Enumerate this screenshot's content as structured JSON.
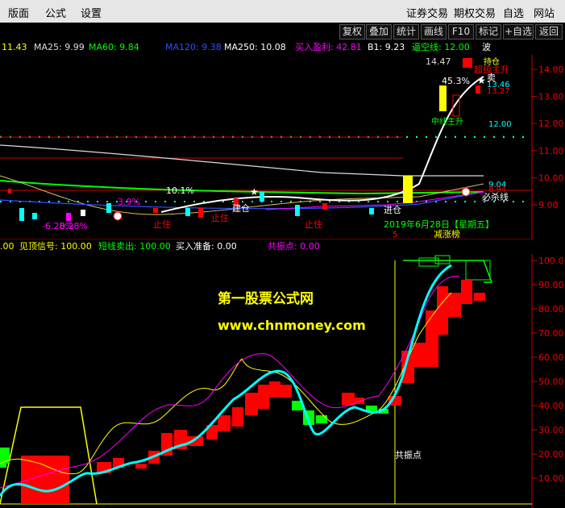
{
  "menu": {
    "items": [
      "版面",
      "公式",
      "设置"
    ],
    "right": [
      "证券交易",
      "期权交易",
      "自选",
      "网站"
    ],
    "min_icon": "minimize-icon"
  },
  "toolbar": {
    "buttons": [
      "复权",
      "叠加",
      "统计",
      "画线",
      "F10",
      "标记",
      "+自选",
      "返回"
    ]
  },
  "header_top": {
    "ma_prefix": "11.43",
    "ma25": "MA25: 9.99",
    "ma60": "MA60: 9.84",
    "ma120": "MA120: 9.38",
    "ma250": "MA250: 10.08",
    "buy_profit": "买入盈利: 42.81",
    "b1": "B1: 9.23",
    "empty_line": "逼空线: 12.00",
    "wave": "波"
  },
  "colors": {
    "bg": "#000000",
    "red": "#ff0000",
    "green": "#00ff00",
    "yellow": "#ffff00",
    "cyan": "#00ffff",
    "magenta": "#ff00ff",
    "axis": "#cc0000"
  },
  "upper_axis": {
    "ticks": [
      "14.00",
      "13.00",
      "12.00",
      "11.00",
      "10.00",
      "9.00"
    ],
    "values": [
      14,
      13,
      12,
      11,
      10,
      9
    ]
  },
  "upper_annotations": {
    "high": "14.47",
    "pct": "45.3%",
    "main_up": "超级主升",
    "main_up2": "中线主升",
    "sell": "卖",
    "v1346": "13.46",
    "v1327": "13.27",
    "v1200": "12.00",
    "v904": "9.04",
    "v894": "8.94",
    "must_sell": "必杀线",
    "pct2": "10.1%",
    "pct3": "3.9%",
    "pct4": "-6.28%",
    "pct5": "0.28%",
    "buy_in": "进仓",
    "stop": "止住",
    "stop2": "止住",
    "stop3": "止住",
    "build": "建仓",
    "date": "2019年6月28日【星期五】",
    "limit_list": "减涨榜",
    "s_marker": "5",
    "hold": "持仓"
  },
  "header_bottom": {
    "prefix": ".00",
    "top_signal": "见顶信号: 100.00",
    "short_sell": "短线卖出: 100.00",
    "buy_prepare": "买入准备: 0.00",
    "resonance": "共振点: 0.00"
  },
  "lower_axis": {
    "ticks": [
      "100.0",
      "90.00",
      "80.00",
      "70.00",
      "60.00",
      "50.00",
      "40.00",
      "30.00",
      "20.00",
      "10.00"
    ],
    "values": [
      100,
      90,
      80,
      70,
      60,
      50,
      40,
      30,
      20,
      10
    ]
  },
  "lower_annotations": {
    "resonance_label": "共振点"
  },
  "watermark": {
    "name": "第一股票公式网",
    "url": "www.chnmoney.com"
  }
}
